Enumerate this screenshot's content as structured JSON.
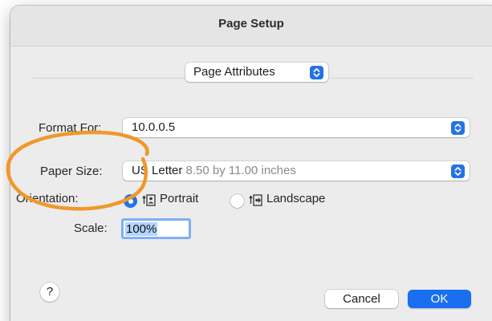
{
  "dialog": {
    "title": "Page Setup"
  },
  "settings_menu": {
    "selected": "Page Attributes"
  },
  "format_for": {
    "label": "Format For:",
    "value": "10.0.0.5"
  },
  "paper_size": {
    "label": "Paper Size:",
    "value": "US Letter",
    "dimensions": "8.50 by 11.00 inches"
  },
  "orientation": {
    "label": "Orientation:",
    "options": [
      {
        "label": "Portrait",
        "selected": true
      },
      {
        "label": "Landscape",
        "selected": false
      }
    ]
  },
  "scale": {
    "label": "Scale:",
    "value": "100%"
  },
  "buttons": {
    "help": "?",
    "cancel": "Cancel",
    "ok": "OK"
  },
  "colors": {
    "accent": "#1a6ef0",
    "annotation": "#f0982a",
    "dialog_background": "#ececec"
  },
  "annotation": {
    "shape": "ellipse",
    "highlights": "paper_size"
  }
}
